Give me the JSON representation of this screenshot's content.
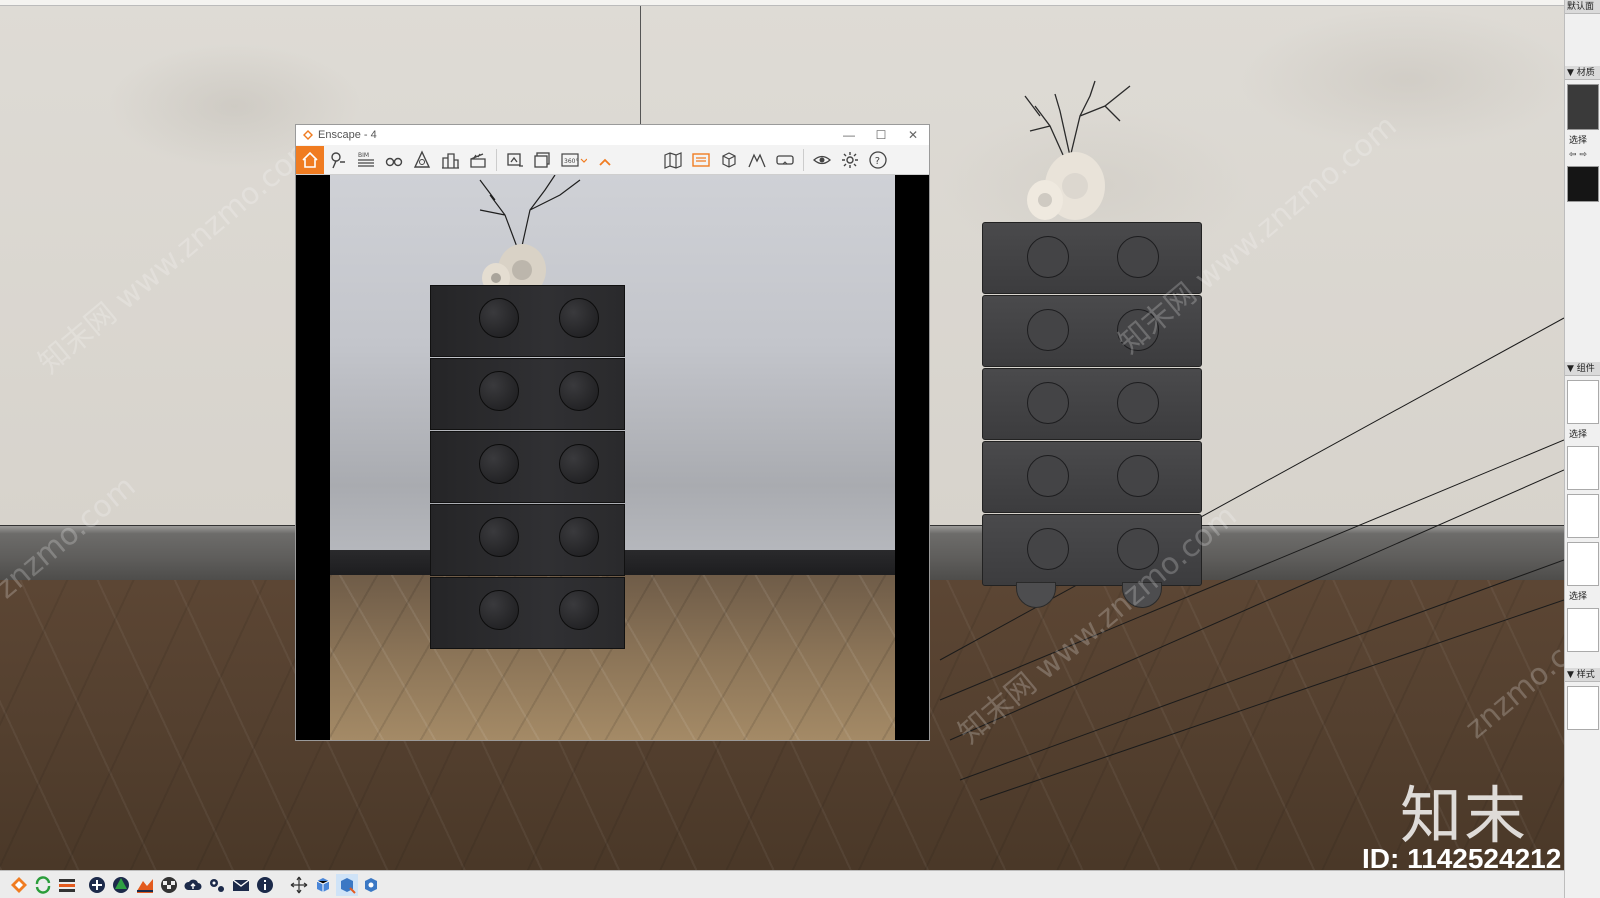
{
  "window": {
    "title": "Enscape - 4",
    "controls": {
      "minimize": "—",
      "maximize": "☐",
      "close": "✕"
    }
  },
  "enscape_toolbar": [
    {
      "id": "home",
      "icon": "home-icon",
      "active": true
    },
    {
      "id": "capture-pin",
      "icon": "pin-icon"
    },
    {
      "id": "bim",
      "icon": "bim-icon"
    },
    {
      "id": "binoculars",
      "icon": "binoculars-icon"
    },
    {
      "id": "asset-library",
      "icon": "asset-library-icon"
    },
    {
      "id": "buildings",
      "icon": "buildings-icon"
    },
    {
      "id": "clapper",
      "icon": "clapper-icon"
    },
    {
      "id": "screenshot",
      "icon": "screenshot-icon"
    },
    {
      "id": "batch-render",
      "icon": "batch-render-icon"
    },
    {
      "id": "panorama",
      "icon": "panorama-360-icon",
      "label": "360°"
    },
    {
      "id": "collapse",
      "icon": "chevron-up-icon"
    },
    {
      "id": "map",
      "icon": "map-icon"
    },
    {
      "id": "views",
      "icon": "views-icon"
    },
    {
      "id": "cube",
      "icon": "cube-icon"
    },
    {
      "id": "mountain",
      "icon": "mountain-icon"
    },
    {
      "id": "vr-headset",
      "icon": "vr-headset-icon"
    },
    {
      "id": "eye",
      "icon": "eye-icon"
    },
    {
      "id": "settings",
      "icon": "gear-icon"
    },
    {
      "id": "help",
      "icon": "help-icon",
      "label": "?"
    }
  ],
  "tray": {
    "sections": [
      {
        "label": "▼ 材质"
      },
      {
        "label": "选择"
      },
      {
        "label": "▼ 组件"
      },
      {
        "label": "选择"
      },
      {
        "label": "选择"
      },
      {
        "label": "▼ 样式"
      }
    ],
    "top_label": "默认面"
  },
  "watermarks": {
    "text": "知末网 www.znzmo.com",
    "short": "znzmo.com"
  },
  "branding": {
    "logo_text": "知末",
    "id_text": "ID: 1142524212"
  },
  "colors": {
    "enscape_accent": "#f07c21",
    "toolbar_bg": "#f3f3f3",
    "floor": "#54402f",
    "wall": "#dad7d0"
  },
  "bottom_toolbar": [
    {
      "icon": "enscape-logo-icon"
    },
    {
      "icon": "sync-icon"
    },
    {
      "icon": "layers-icon"
    },
    {
      "icon": "add-icon"
    },
    {
      "icon": "tree-icon"
    },
    {
      "icon": "terrain-icon"
    },
    {
      "icon": "checker-icon"
    },
    {
      "icon": "cloud-upload-icon"
    },
    {
      "icon": "gears-icon"
    },
    {
      "icon": "mail-icon"
    },
    {
      "icon": "info-icon"
    },
    {
      "icon": "move-icon"
    },
    {
      "icon": "cube-blue-icon"
    },
    {
      "icon": "cube-export-icon"
    },
    {
      "icon": "cube-settings-icon"
    }
  ]
}
